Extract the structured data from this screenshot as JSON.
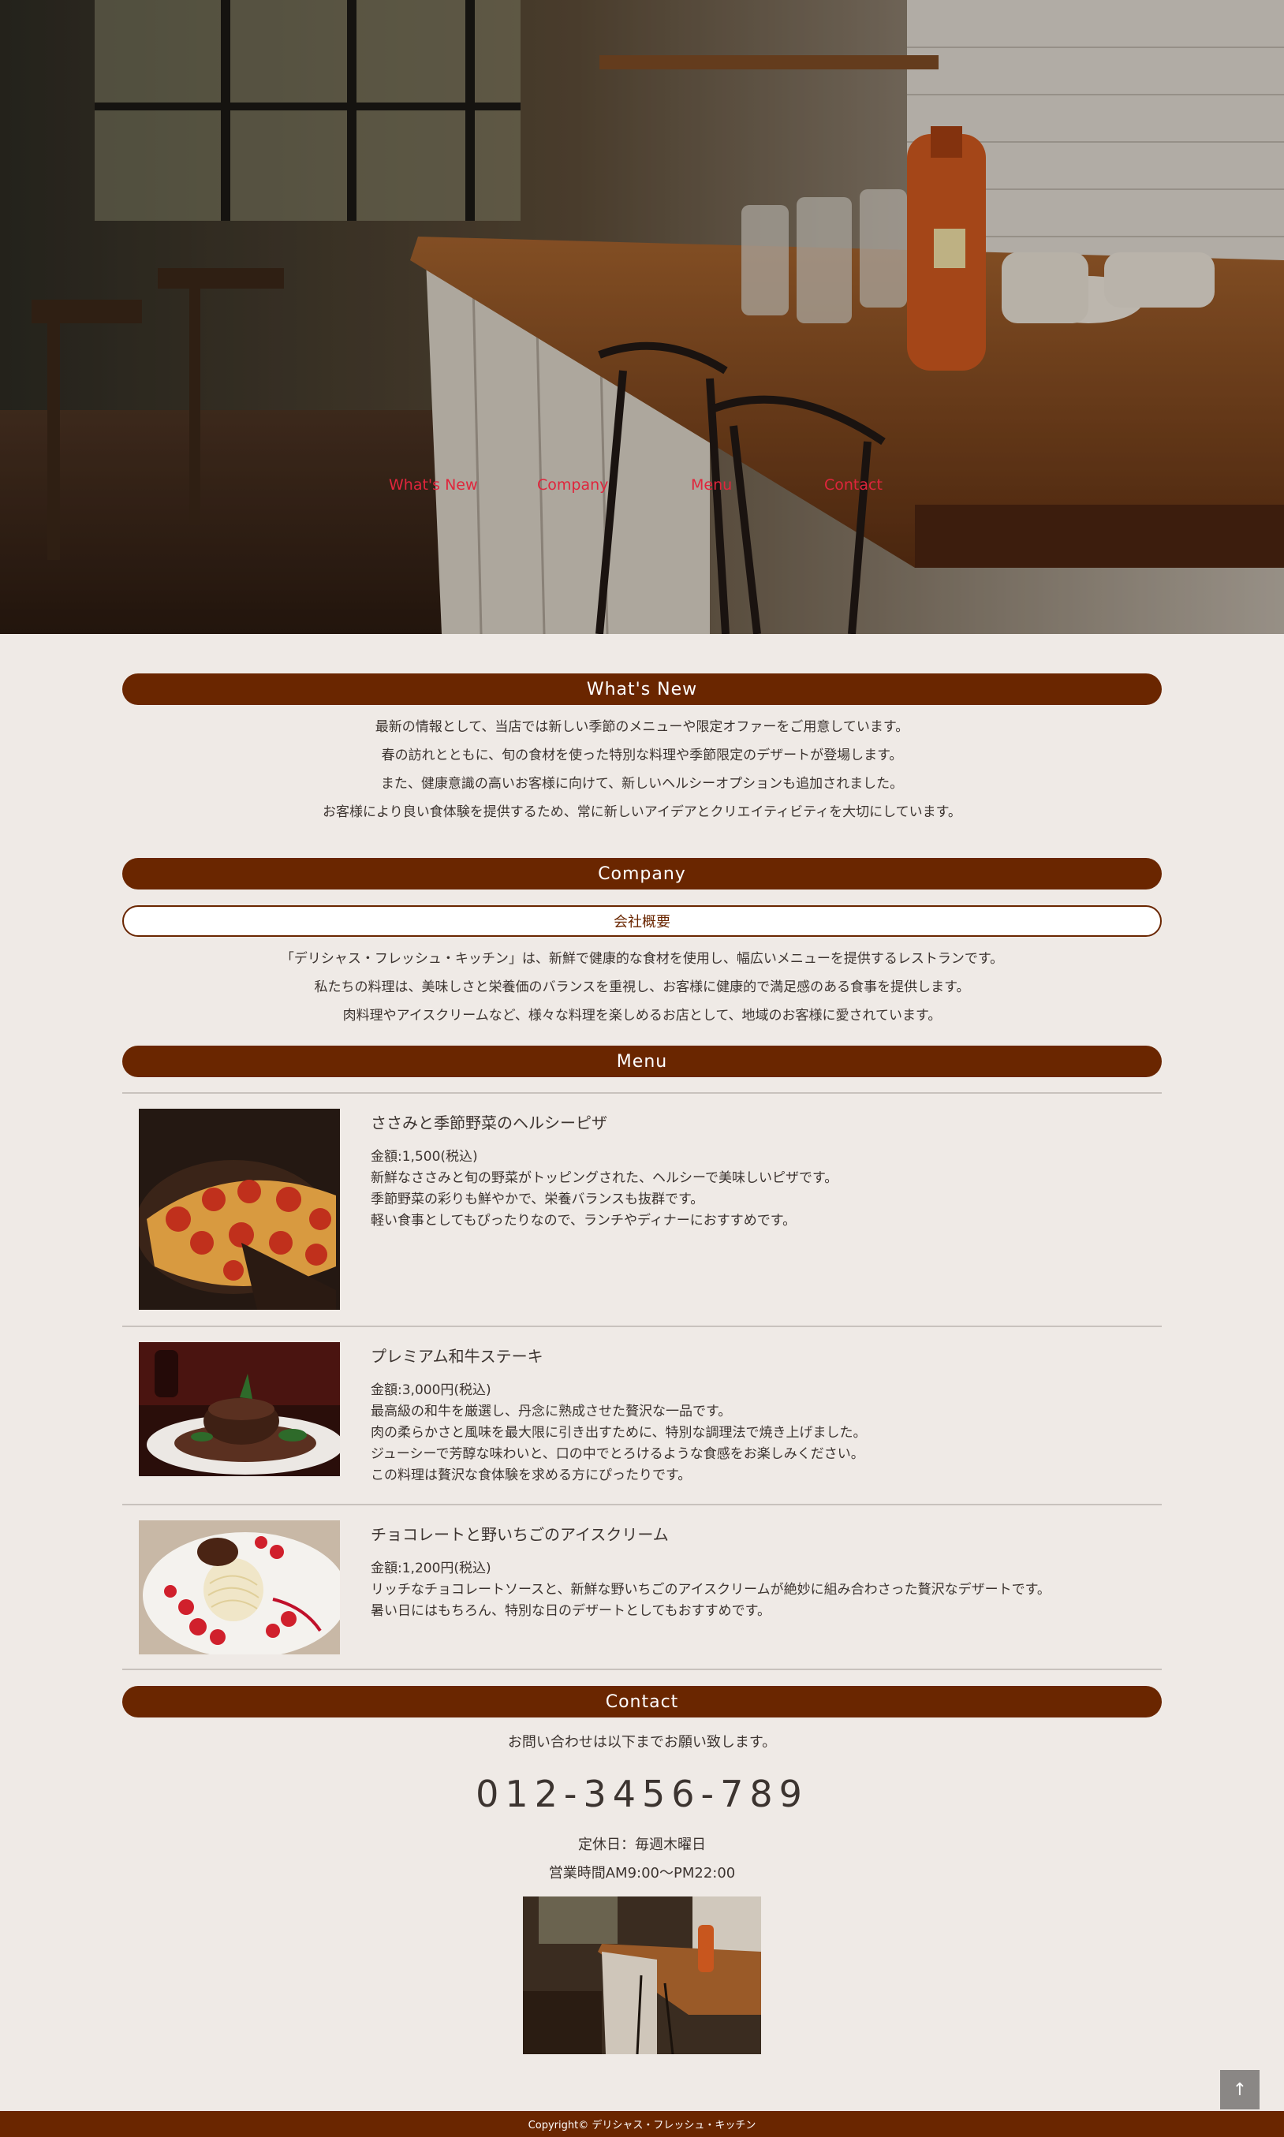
{
  "nav": {
    "items": [
      {
        "label": "What's New"
      },
      {
        "label": "Company"
      },
      {
        "label": "Menu"
      },
      {
        "label": "Contact"
      }
    ]
  },
  "colors": {
    "accent": "#6a2600",
    "nav_link": "#e0253c",
    "background": "#efeae6"
  },
  "whats_new": {
    "heading": "What's New",
    "lines": [
      "最新の情報として、当店では新しい季節のメニューや限定オファーをご用意しています。",
      "春の訪れとともに、旬の食材を使った特別な料理や季節限定のデザートが登場します。",
      "また、健康意識の高いお客様に向けて、新しいヘルシーオプションも追加されました。",
      "お客様により良い食体験を提供するため、常に新しいアイデアとクリエイティビティを大切にしています。"
    ]
  },
  "company": {
    "heading": "Company",
    "subheading": "会社概要",
    "lines": [
      "「デリシャス・フレッシュ・キッチン」は、新鮮で健康的な食材を使用し、幅広いメニューを提供するレストランです。",
      "私たちの料理は、美味しさと栄養価のバランスを重視し、お客様に健康的で満足感のある食事を提供します。",
      "肉料理やアイスクリームなど、様々な料理を楽しめるお店として、地域のお客様に愛されています。"
    ]
  },
  "menu": {
    "heading": "Menu",
    "items": [
      {
        "name": "ささみと季節野菜のヘルシーピザ",
        "image_icon": "pizza-image",
        "lines": [
          "金額:1,500(税込)",
          "新鮮なささみと旬の野菜がトッピングされた、ヘルシーで美味しいピザです。",
          "季節野菜の彩りも鮮やかで、栄養バランスも抜群です。",
          "軽い食事としてもぴったりなので、ランチやディナーにおすすめです。"
        ]
      },
      {
        "name": "プレミアム和牛ステーキ",
        "image_icon": "steak-image",
        "lines": [
          "金額:3,000円(税込)",
          "最高級の和牛を厳選し、丹念に熟成させた贅沢な一品です。",
          "肉の柔らかさと風味を最大限に引き出すために、特別な調理法で焼き上げました。",
          "ジューシーで芳醇な味わいと、口の中でとろけるような食感をお楽しみください。",
          "この料理は贅沢な食体験を求める方にぴったりです。"
        ]
      },
      {
        "name": "チョコレートと野いちごのアイスクリーム",
        "image_icon": "ice-cream-image",
        "lines": [
          "金額:1,200円(税込)",
          "リッチなチョコレートソースと、新鮮な野いちごのアイスクリームが絶妙に組み合わさった贅沢なデザートです。",
          "暑い日にはもちろん、特別な日のデザートとしてもおすすめです。"
        ]
      }
    ]
  },
  "contact": {
    "heading": "Contact",
    "intro": "お問い合わせは以下までお願い致します。",
    "phone": "012-3456-789",
    "closed": "定休日：毎週木曜日",
    "hours": "営業時間AM9:00〜PM22:00"
  },
  "to_top": {
    "label": "↑"
  },
  "footer": {
    "copyright": "Copyright© デリシャス・フレッシュ・キッチン"
  }
}
